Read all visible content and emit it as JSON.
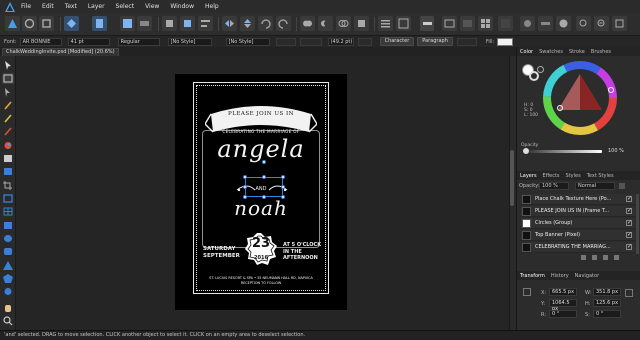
{
  "menubar": {
    "items": [
      "File",
      "Edit",
      "Text",
      "Layer",
      "Select",
      "View",
      "Window",
      "Help"
    ]
  },
  "context": {
    "font_label": "Font:",
    "font_family": "AR BONNIE",
    "font_size": "41 pt",
    "font_weight": "Regular",
    "char_style": "[No Style]",
    "para_style": "[No Style]",
    "leading": "(49.2 pt)",
    "character_btn": "Character",
    "paragraph_btn": "Paragraph",
    "fill_label": "Fill:"
  },
  "document": {
    "tab_title": "ChalkWeddingInvite.psd [Modified] (20.6%)"
  },
  "invite": {
    "please": "PLEASE JOIN US IN",
    "celebrating": "CELEBRATING THE MARRIAGE OF",
    "bride": "angela",
    "and": "AND",
    "groom": "noah",
    "day_of_week": "SATURDAY",
    "month": "SEPTEMBER",
    "date": "23",
    "year": "2016",
    "time_line1": "AT 5 O'CLOCK",
    "time_line2": "IN THE",
    "time_line3": "AFTERNOON",
    "address_line1": "ST. LUCIUS RESORT & SPA • 35 NEUMANN HALL RD, NAPVICA",
    "address_line2": "RECEPTION TO FOLLOW"
  },
  "rightpanel": {
    "top_tabs": [
      "Color",
      "Swatches",
      "Stroke",
      "Brushes"
    ],
    "hsl": [
      "H: 0",
      "S: 0",
      "L: 100"
    ],
    "opacity_label": "Opacity",
    "opacity_value": "100 %",
    "layers_tabs": [
      "Layers",
      "Effects",
      "Styles",
      "Text Styles"
    ],
    "layers_opacity_label": "Opacity:",
    "layers_opacity_value": "100 %",
    "blend_mode": "Normal",
    "layers": [
      "Place Chalk Texture Here (Po...",
      "PLEASE JOIN US IN (Frame T...",
      "Circles (Group)",
      "Top Banner (Pixel)",
      "CELEBRATING THE MARRIAG..."
    ],
    "transform_tabs": [
      "Transform",
      "History",
      "Navigator"
    ],
    "transform": {
      "x_label": "X:",
      "x": "665.5 px",
      "y_label": "Y:",
      "y": "1064.5 px",
      "w_label": "W:",
      "w": "351.8 px",
      "h_label": "H:",
      "h": "125.6 px",
      "r_label": "R:",
      "r": "0 °",
      "s_label": "S:",
      "s": "0 °"
    }
  },
  "status": {
    "text": "'and' selected. DRAG to move selection. CLICK another object to select it. CLICK on an empty area to deselect selection."
  },
  "colors": {
    "accent": "#3b7fd9",
    "canvas_bg": "#252525",
    "panel_bg": "#2c2c2c",
    "card_bg": "#000000",
    "chalk": "#f4f4f4"
  }
}
